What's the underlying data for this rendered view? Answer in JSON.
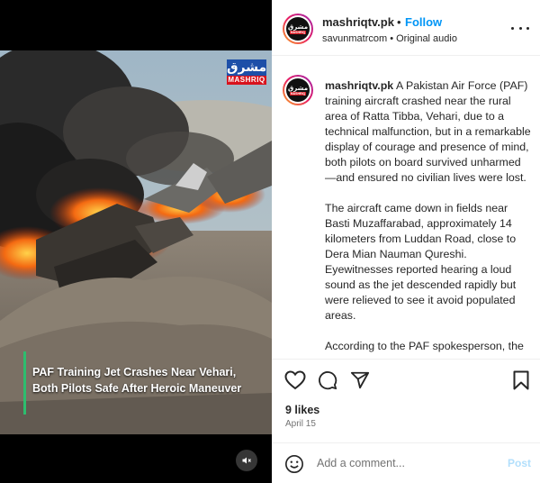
{
  "video": {
    "channel_logo_top": "مشرق",
    "channel_logo_bottom": "MASHRIQ",
    "caption_line1": "PAF Training Jet Crashes Near Vehari,",
    "caption_line2": "Both Pilots Safe After Heroic Maneuver",
    "mute_icon": "speaker-muted-icon"
  },
  "header": {
    "avatar_text_top": "مشرق",
    "avatar_text_bottom": "MASHRIQ",
    "username": "mashriqtv.pk",
    "separator": "•",
    "follow_label": "Follow",
    "audio_label": "savunmatrcom • Original audio"
  },
  "post": {
    "username": "mashriqtv.pk",
    "paragraphs": [
      "A Pakistan Air Force (PAF) training aircraft crashed near the rural area of Ratta Tibba, Vehari, due to a technical malfunction, but in a remarkable display of courage and presence of mind, both pilots on board survived unharmed—and ensured no civilian lives were lost.",
      "The aircraft came down in fields near Basti Muzaffarabad, approximately 14 kilometers from Luddan Road, close to Dera Mian Nauman Qureshi. Eyewitnesses reported hearing a loud sound as the jet descended rapidly but were relieved to see it avoid populated areas.",
      "According to the PAF spokesperson, the"
    ]
  },
  "actions": {
    "like_icon": "heart-icon",
    "comment_icon": "comment-icon",
    "share_icon": "send-icon",
    "save_icon": "bookmark-icon"
  },
  "stats": {
    "likes": "9 likes",
    "date": "April 15"
  },
  "composer": {
    "placeholder": "Add a comment...",
    "post_label": "Post"
  },
  "colors": {
    "accent": "#0095f6",
    "post_disabled": "#b2dffc",
    "caption_bar": "#2dbd6e"
  }
}
